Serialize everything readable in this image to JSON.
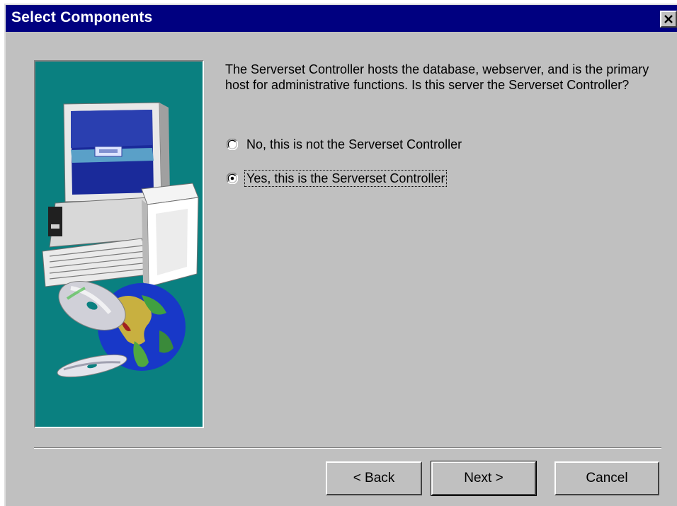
{
  "window": {
    "title": "Select Components"
  },
  "content": {
    "description": "The Serverset Controller hosts the database, webserver, and is the primary host for administrative functions.  Is this server the Serverset Controller?",
    "options": [
      {
        "label": "No, this is not the Serverset Controller",
        "selected": false
      },
      {
        "label": "Yes, this is the Serverset Controller",
        "selected": true
      }
    ]
  },
  "buttons": {
    "back": "< Back",
    "next": "Next >",
    "cancel": "Cancel"
  },
  "colors": {
    "titlebar": "#000080",
    "dialog_bg": "#c0c0c0",
    "illustration_bg": "#0a8080"
  },
  "icons": {
    "close": "close-icon",
    "illustration": "computer-and-globe-illustration"
  }
}
